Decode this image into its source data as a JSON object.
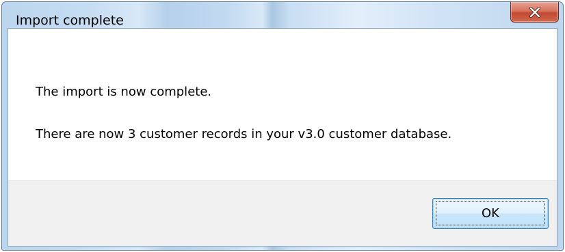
{
  "window": {
    "title": "Import complete",
    "close_icon": "close-x-icon",
    "close_color": "#c9513a"
  },
  "message": {
    "line1": "The import is now complete.",
    "line2": "There are now 3 customer records in your v3.0 customer database."
  },
  "footer": {
    "ok_label": "OK"
  }
}
